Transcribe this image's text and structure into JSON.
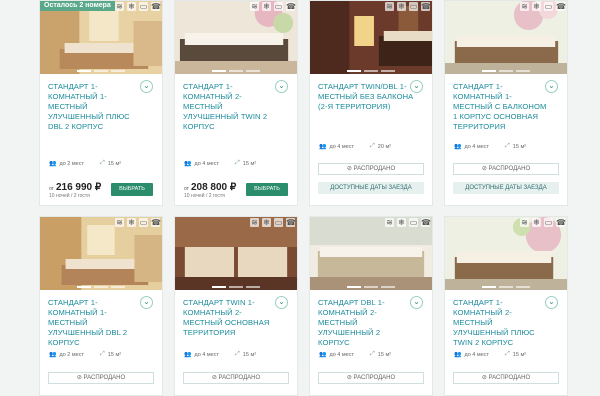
{
  "cards": [
    {
      "badge": "Осталось 2 номера",
      "title": "Стандарт 1-комнатный 1-местный Улучшенный плюс DBL 2 корпус",
      "guests": "до 2 мест",
      "area": "15 м²",
      "price_from": "от",
      "price": "216 990 ₽",
      "nights": "10 ночей / 2 гостя",
      "action": "ВЫБРАТЬ"
    },
    {
      "badge": "",
      "title": "Стандарт 1-комнатный 2-местный Улучшенный TWIN 2 корпус",
      "guests": "до 4 мест",
      "area": "15 м²",
      "price_from": "от",
      "price": "208 800 ₽",
      "nights": "10 ночей / 2 гостя",
      "action": "ВЫБРАТЬ"
    },
    {
      "badge": "",
      "title": "Стандарт TWIN/DBL 1-местный без балкона (2-я территория)",
      "guests": "до 4 мест",
      "area": "20 м²",
      "sold": "РАСПРОДАНО",
      "dates": "ДОСТУПНЫЕ ДАТЫ ЗАЕЗДА"
    },
    {
      "badge": "",
      "title": "Стандарт 1-комнатный 1-местный с балконом 1 корпус основная территория",
      "guests": "до 4 мест",
      "area": "15 м²",
      "sold": "РАСПРОДАНО",
      "dates": "ДОСТУПНЫЕ ДАТЫ ЗАЕЗДА"
    },
    {
      "badge": "",
      "title": "Стандарт 1-комнатный 1-местный Улучшенный DBL 2 корпус",
      "guests": "до 2 мест",
      "area": "15 м²",
      "sold": "РАСПРОДАНО"
    },
    {
      "badge": "",
      "title": "Стандарт TWIN 1-комнатный 2-местный основная территория",
      "guests": "до 4 мест",
      "area": "15 м²",
      "sold": "РАСПРОДАНО"
    },
    {
      "badge": "",
      "title": "Стандарт DBL 1-комнатный 2-местный Улучшенный 2 корпус",
      "guests": "до 4 мест",
      "area": "15 м²",
      "sold": "РАСПРОДАНО"
    },
    {
      "badge": "",
      "title": "Стандарт 1-комнатный 2-местный Улучшенный плюс TWIN 2 корпус",
      "guests": "до 4 мест",
      "area": "15 м²",
      "sold": "РАСПРОДАНО"
    }
  ],
  "amenity_icons": [
    "wifi-icon",
    "snowflake-icon",
    "tv-icon",
    "phone-icon"
  ],
  "amenity_glyphs": [
    "≋",
    "❄",
    "▭",
    "☎"
  ],
  "chevron": "⌄",
  "guests_glyph": "👥",
  "area_glyph": "⤢",
  "sold_glyph": "⊘",
  "colors": {
    "accent": "#1a8b9b",
    "button": "#2b8d6b",
    "badge": "#5aa88a"
  }
}
